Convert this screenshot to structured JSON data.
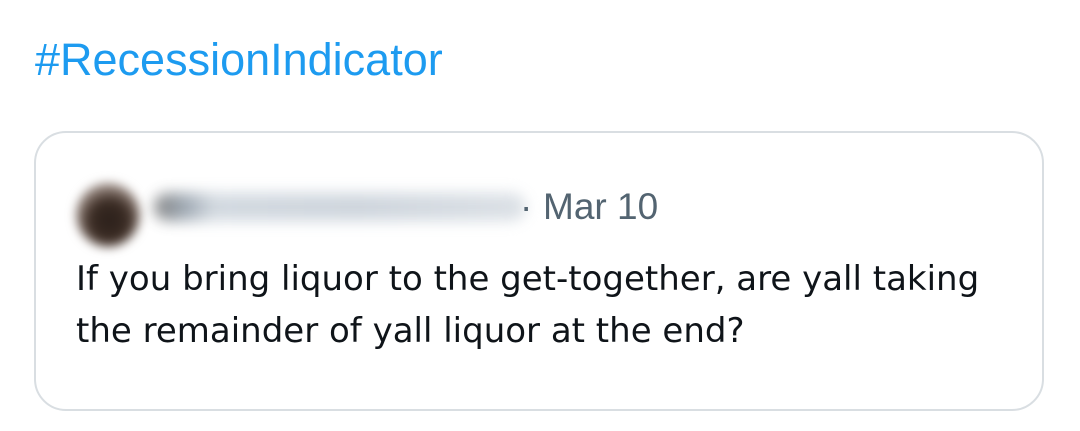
{
  "hashtag": "#RecessionIndicator",
  "quoted_post": {
    "separator": "·",
    "date": "Mar 10",
    "text": "If you bring liquor to the get-together, are yall taking the remainder of yall liquor at the end?"
  },
  "colors": {
    "link": "#1d9bf0",
    "secondary_text": "#536471",
    "primary_text": "#0f1419",
    "card_border": "#d9dee2"
  }
}
